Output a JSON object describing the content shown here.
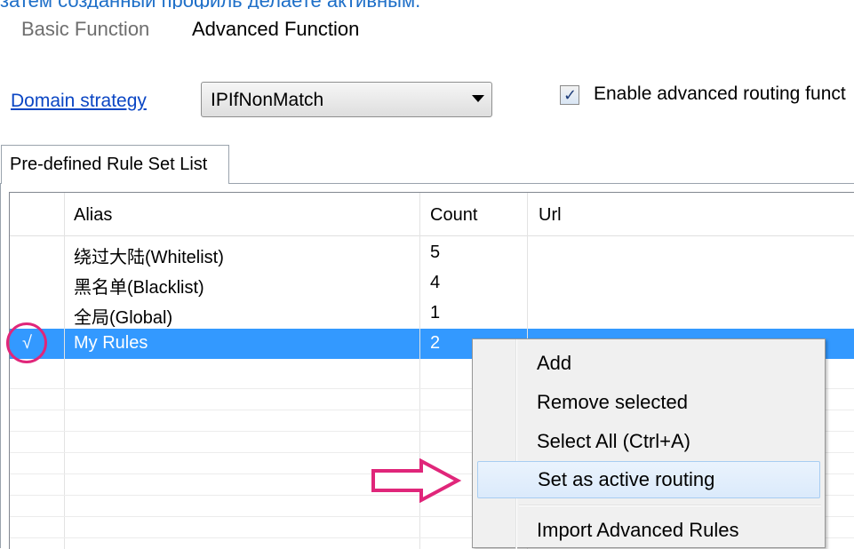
{
  "caption": "затем созданный профиль делаете активным.",
  "tabs": [
    "Basic Function",
    "Advanced Function"
  ],
  "domain_strategy": {
    "label": "Domain strategy",
    "value": "IPIfNonMatch"
  },
  "enable_routing": {
    "label": "Enable advanced routing funct",
    "checked": true
  },
  "subtab": "Pre-defined Rule Set List",
  "grid": {
    "headers": {
      "alias": "Alias",
      "count": "Count",
      "url": "Url"
    },
    "rows": [
      {
        "mark": "",
        "alias": "绕过大陆(Whitelist)",
        "count": "5",
        "url": ""
      },
      {
        "mark": "",
        "alias": "黑名单(Blacklist)",
        "count": "4",
        "url": ""
      },
      {
        "mark": "",
        "alias": "全局(Global)",
        "count": "1",
        "url": ""
      },
      {
        "mark": "√",
        "alias": "My Rules",
        "count": "2",
        "url": ""
      }
    ]
  },
  "context_menu": {
    "items": [
      "Add",
      "Remove selected",
      "Select All (Ctrl+A)",
      "Set as active routing",
      "Import Advanced Rules"
    ]
  },
  "colors": {
    "selection": "#3399ff",
    "annotation": "#e0267a",
    "link": "#0b46c4"
  }
}
